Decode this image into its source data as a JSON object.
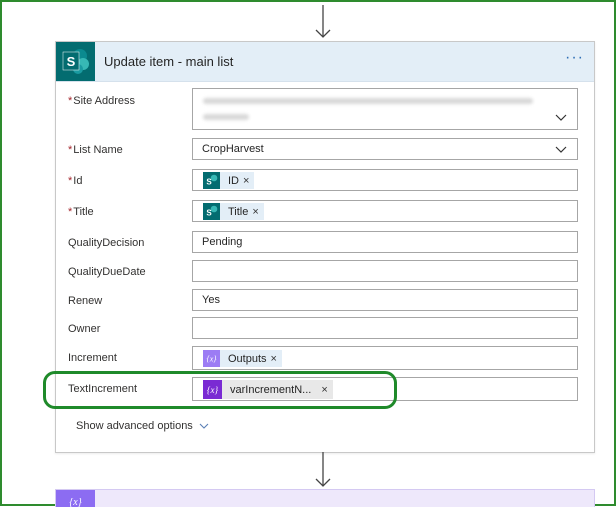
{
  "action": {
    "title": "Update item - main list",
    "more_label": "···"
  },
  "fields": {
    "site_address": {
      "label": "Site Address"
    },
    "list_name": {
      "label": "List Name",
      "value": "CropHarvest"
    },
    "id": {
      "label": "Id",
      "token": "ID"
    },
    "title": {
      "label": "Title",
      "token": "Title"
    },
    "quality_decision": {
      "label": "QualityDecision",
      "value": "Pending"
    },
    "quality_due_date": {
      "label": "QualityDueDate",
      "value": ""
    },
    "renew": {
      "label": "Renew",
      "value": "Yes"
    },
    "owner": {
      "label": "Owner",
      "value": ""
    },
    "increment": {
      "label": "Increment",
      "token": "Outputs"
    },
    "text_increment": {
      "label": "TextIncrement",
      "token": "varIncrementN..."
    }
  },
  "required_marker": "*",
  "remove_token_glyph": "×",
  "advanced_options_label": "Show advanced options",
  "icons": {
    "sharepoint": "sharepoint-icon",
    "expression": "expression-icon",
    "variable": "variable-icon",
    "chevron": "chevron-down-icon",
    "flow_arrow": "arrow-down-icon"
  },
  "colors": {
    "sharepoint_brand": "#036c70",
    "header_bg": "#e3eef7",
    "expression_token": "#9c7cf4",
    "variable_token": "#7a2bd3",
    "required": "#a4262c",
    "highlight": "#1f8a2a"
  }
}
